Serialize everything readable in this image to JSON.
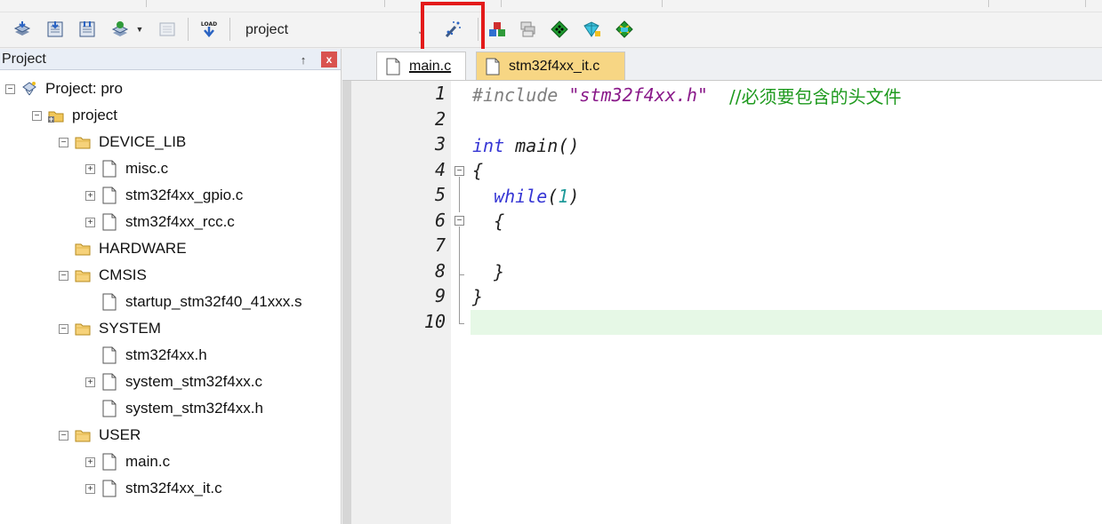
{
  "toolbar": {
    "target_name": "project",
    "buttons": [
      {
        "icon": "translate-icon"
      },
      {
        "icon": "build-icon"
      },
      {
        "icon": "rebuild-icon"
      },
      {
        "icon": "batch-build-icon"
      },
      {
        "icon": "stop-build-icon"
      },
      {
        "icon": "load-download-icon",
        "text": "LOAD"
      },
      {
        "icon": "magic-wand-options-icon"
      },
      {
        "icon": "file-extensions-icon"
      },
      {
        "icon": "manage-components-icon"
      },
      {
        "icon": "select-packs-icon"
      },
      {
        "icon": "pack-installer-icon"
      },
      {
        "icon": "environment-icon"
      }
    ],
    "highlight_color": "#e31a1a"
  },
  "project_panel": {
    "title": "Project",
    "pin_glyph": "↑",
    "close_glyph": "x",
    "tree": [
      {
        "label": "Project: pro",
        "level": 0,
        "type": "root",
        "toggle": "−"
      },
      {
        "label": "project",
        "level": 1,
        "type": "target",
        "toggle": "−"
      },
      {
        "label": "DEVICE_LIB",
        "level": 2,
        "type": "folder",
        "toggle": "−"
      },
      {
        "label": "misc.c",
        "level": 3,
        "type": "file",
        "toggle": "+"
      },
      {
        "label": "stm32f4xx_gpio.c",
        "level": 3,
        "type": "file",
        "toggle": "+"
      },
      {
        "label": "stm32f4xx_rcc.c",
        "level": 3,
        "type": "file",
        "toggle": "+"
      },
      {
        "label": "HARDWARE",
        "level": 2,
        "type": "folder",
        "toggle": ""
      },
      {
        "label": "CMSIS",
        "level": 2,
        "type": "folder",
        "toggle": "−"
      },
      {
        "label": "startup_stm32f40_41xxx.s",
        "level": 3,
        "type": "file",
        "toggle": ""
      },
      {
        "label": "SYSTEM",
        "level": 2,
        "type": "folder",
        "toggle": "−"
      },
      {
        "label": "stm32f4xx.h",
        "level": 3,
        "type": "file",
        "toggle": ""
      },
      {
        "label": "system_stm32f4xx.c",
        "level": 3,
        "type": "file",
        "toggle": "+"
      },
      {
        "label": "system_stm32f4xx.h",
        "level": 3,
        "type": "file",
        "toggle": ""
      },
      {
        "label": "USER",
        "level": 2,
        "type": "folder",
        "toggle": "−"
      },
      {
        "label": "main.c",
        "level": 3,
        "type": "file",
        "toggle": "+"
      },
      {
        "label": "stm32f4xx_it.c",
        "level": 3,
        "type": "file",
        "toggle": "+"
      }
    ]
  },
  "editor": {
    "tabs": [
      {
        "label": "main.c",
        "active": true
      },
      {
        "label": "stm32f4xx_it.c",
        "active": false
      }
    ],
    "line_numbers": [
      "1",
      "2",
      "3",
      "4",
      "5",
      "6",
      "7",
      "8",
      "9",
      "10"
    ],
    "code": {
      "l1_pre": "#include",
      "l1_str": "\"stm32f4xx.h\"",
      "l1_cmt": "//必须要包含的头文件",
      "l3_kw": "int",
      "l3_rest": " main()",
      "l4": "{",
      "l5_kw": "while",
      "l5_open": "(",
      "l5_num": "1",
      "l5_close": ")",
      "l6": "{",
      "l8": "}",
      "l9": "}"
    },
    "current_line": 10,
    "colors": {
      "preprocessor": "#7f7f7f",
      "string": "#8a1a8a",
      "comment": "#1f9a1f",
      "keyword": "#3535d4",
      "number": "#1f9a9a",
      "current_line_bg": "#e6f8e6"
    }
  }
}
